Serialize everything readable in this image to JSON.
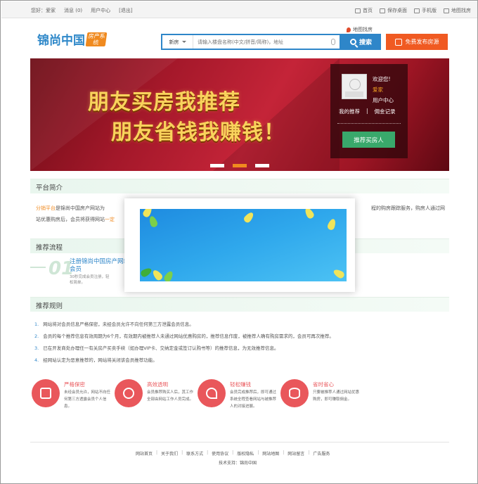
{
  "topbar": {
    "greeting": "您好：爱家",
    "messages": "消息 (0)",
    "user_center": "用户中心",
    "logout": "[退出]",
    "home": "首页",
    "save_desktop": "保存桌面",
    "mobile": "手机版",
    "map": "地图找房"
  },
  "header": {
    "logo_text": "锦尚中国",
    "logo_tag": "房产系统",
    "map_link": "地图找房",
    "search_select": "新房",
    "search_placeholder": "请输入楼盘名称(中文/拼音/简称)，地址",
    "search_button": "搜索",
    "publish_button": "免费发布房源"
  },
  "banner": {
    "line1": "朋友买房我推荐",
    "line2": "朋友省钱我赚钱！",
    "colors": {
      "accent": "#f08a1f",
      "text": "#f9d35c"
    }
  },
  "user_panel": {
    "welcome": "欢迎您!",
    "username": "爱家",
    "user_center": "用户中心",
    "my_recommend": "我的推荐",
    "separator": "|",
    "commission": "佣金记录",
    "recommend_button": "推荐买房人"
  },
  "intro": {
    "heading": "平台简介",
    "highlight1": "分销平台",
    "text1": "是锦尚中国房产网站为",
    "text2": "程的购房跟踪服务，购房人通过网",
    "text3": "站优惠购房后，会员将获得网站",
    "highlight2": "一定"
  },
  "process": {
    "heading": "推荐流程",
    "step_num": "01",
    "step_title": "注册锦尚中国房产网站会员",
    "step_sub": "30秒完成会员注册，轻松简单。"
  },
  "rules": {
    "heading": "推荐规则",
    "items": [
      {
        "n": "1.",
        "text": "网站将对会员信息严格保密，未经会员允许不向任何第三方泄露会员信息。"
      },
      {
        "n": "2.",
        "text": "会员的每个推荐信息有效周期为6个月，有效期内被推荐人未通过网站优惠购房的，推荐信息作废，被推荐人确有购房需求的，会员可再次推荐。"
      },
      {
        "n": "3.",
        "text": "已在开发商处办理任一有关房产买卖手续（如办理VIP卡、交纳定金或签订认购书等）的推荐信息，为无效推荐信息。"
      },
      {
        "n": "4.",
        "text": "经网站认定为恶意推荐的，网站将关闭该会员推荐功能。"
      }
    ]
  },
  "features": [
    {
      "title": "严格保密",
      "desc": "未经会员允许，网站不向任何第三方透露会员个人信息。"
    },
    {
      "title": "高效透明",
      "desc": "会员推荐购买人后，其工作全部由网站工作人员完成。"
    },
    {
      "title": "轻松赚钱",
      "desc": "会员完成推荐后，即可通过系统全程查看网站与被推荐人的对接进展。"
    },
    {
      "title": "省时省心",
      "desc": "只要被推荐人通过网站优惠购房，即可赚取佣金。"
    }
  ],
  "footer": {
    "links": [
      "网站首页",
      "关于我们",
      "联系方式",
      "使用协议",
      "版权隐私",
      "网站地图",
      "网站留言",
      "广告服务"
    ],
    "tech_support": "技术支持：锦尚中国"
  }
}
